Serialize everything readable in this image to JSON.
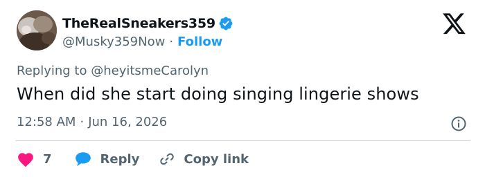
{
  "user": {
    "display_name": "TheRealSneakers359",
    "handle": "@Musky359Now",
    "separator": "·",
    "follow_label": "Follow",
    "verified": true,
    "verified_color": "#1d9bf0"
  },
  "tweet": {
    "replying_prefix": "Replying to",
    "replying_to": "@heyitsmeCarolyn",
    "text": "When did she start doing singing lingerie shows",
    "time": "12:58 AM",
    "date": "Jun 16, 2026",
    "meta_separator": "·"
  },
  "actions": {
    "like_count": "7",
    "reply_label": "Reply",
    "copy_link_label": "Copy link"
  },
  "icons": {
    "platform": "x-logo-icon",
    "info": "info-icon",
    "like": "heart-icon",
    "reply": "reply-bubble-icon",
    "copy_link": "link-icon"
  },
  "colors": {
    "accent": "#1d9bf0",
    "like": "#f91880",
    "text": "#0f1419",
    "muted": "#536471"
  }
}
